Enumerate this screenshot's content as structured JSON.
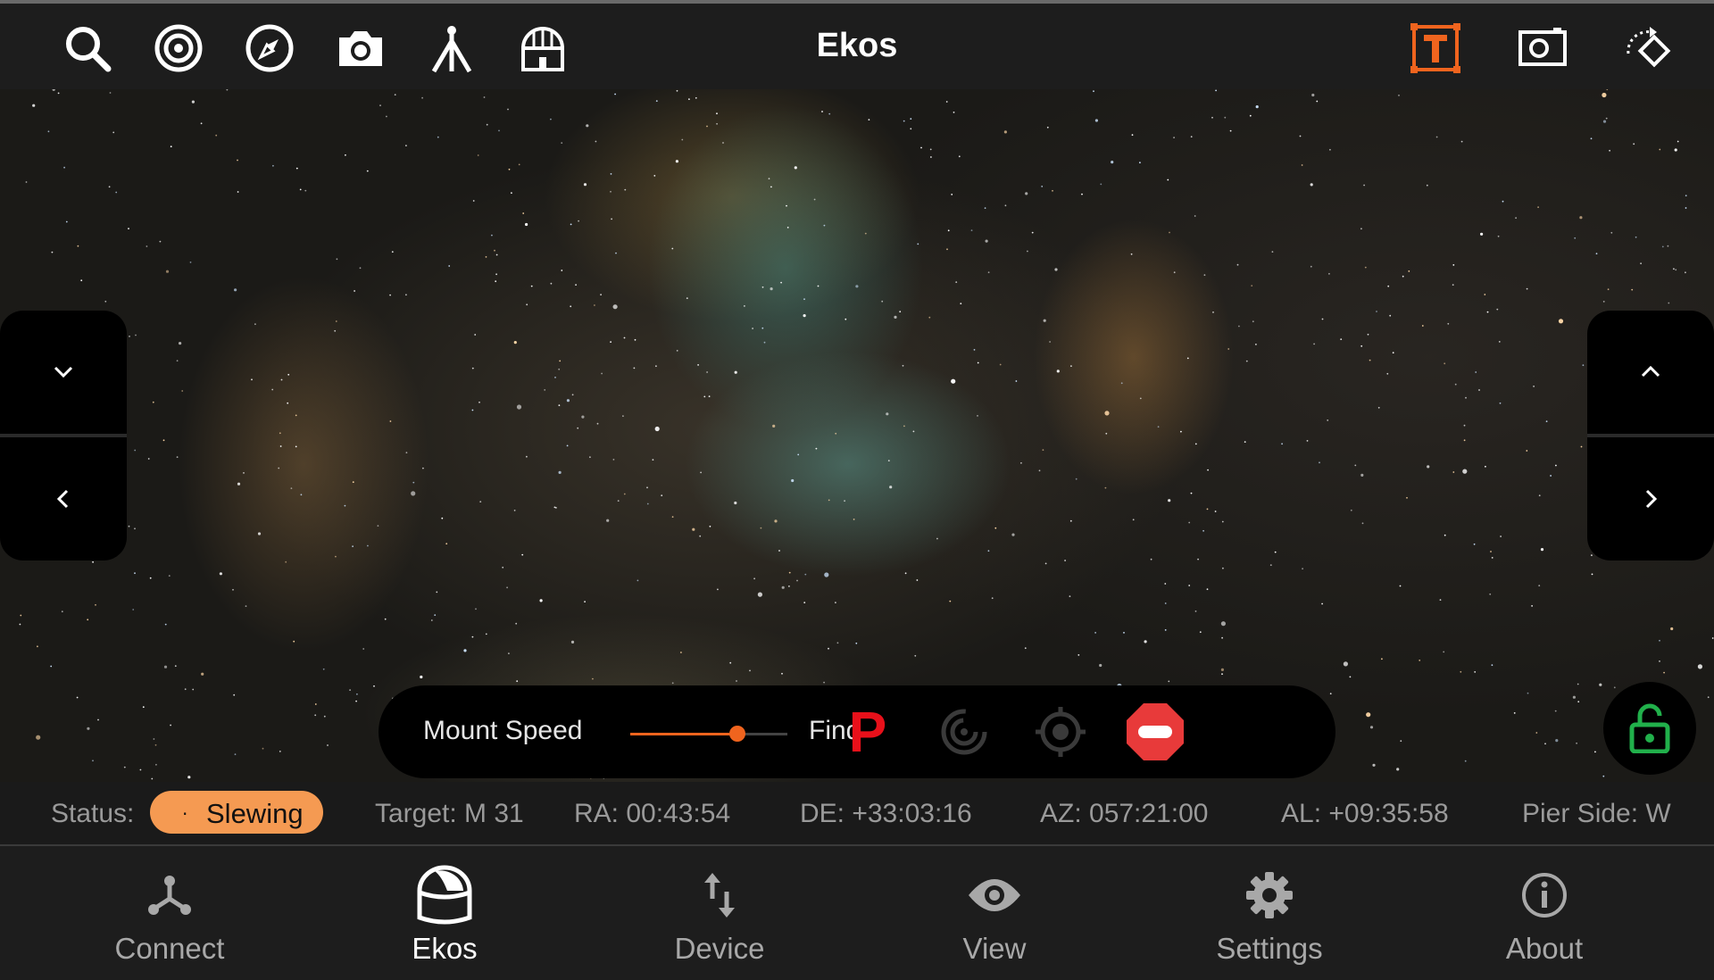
{
  "app": {
    "title": "Ekos",
    "accent_color": "#f0641e"
  },
  "toolbar": {
    "left_icons": [
      "search-icon",
      "target-icon",
      "compass-icon",
      "camera-icon",
      "telescope-mount-icon",
      "observatory-dome-icon"
    ],
    "right_icons": [
      "text-box-icon",
      "snapshot-icon",
      "rotate-icon"
    ]
  },
  "direction_pad": {
    "left": [
      "chevron-down-icon",
      "chevron-left-icon"
    ],
    "right": [
      "chevron-up-icon",
      "chevron-right-icon"
    ]
  },
  "mount_control": {
    "label": "Mount Speed",
    "speed_value": "Find",
    "speed_fraction": 0.68,
    "park_label": "P",
    "buttons": [
      "park-icon",
      "tracking-icon",
      "goto-target-icon",
      "stop-icon"
    ]
  },
  "status": {
    "status_label": "Status:",
    "status_value": "Slewing",
    "status_color": "#f59a52",
    "target": "Target: M 31",
    "ra": "RA: 00:43:54",
    "de": "DE: +33:03:16",
    "az": "AZ: 057:21:00",
    "al": "AL: +09:35:58",
    "pier_side": "Pier Side: W"
  },
  "nav": {
    "items": [
      {
        "label": "Connect",
        "icon": "connect-icon"
      },
      {
        "label": "Ekos",
        "icon": "dome-icon"
      },
      {
        "label": "Device",
        "icon": "device-arrows-icon"
      },
      {
        "label": "View",
        "icon": "eye-icon"
      },
      {
        "label": "Settings",
        "icon": "gear-icon"
      },
      {
        "label": "About",
        "icon": "info-icon"
      }
    ],
    "active": "Ekos"
  }
}
